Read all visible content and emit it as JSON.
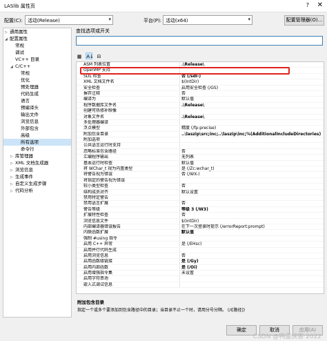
{
  "window": {
    "title": "LASlib 属性页",
    "help": "?",
    "close": "✕"
  },
  "config": {
    "config_label": "配置(C):",
    "config_value": "活动(Release)",
    "platform_label": "平台(P):",
    "platform_value": "活动(x64)",
    "manager_button": "配置管理器(O)..."
  },
  "tree": {
    "items": [
      {
        "label": "通用属性",
        "level": 0,
        "twisty": "▷"
      },
      {
        "label": "配置属性",
        "level": 0,
        "twisty": "◢"
      },
      {
        "label": "常规",
        "level": 1,
        "twisty": ""
      },
      {
        "label": "调试",
        "level": 1,
        "twisty": ""
      },
      {
        "label": "VC++ 目录",
        "level": 1,
        "twisty": ""
      },
      {
        "label": "C/C++",
        "level": 1,
        "twisty": "◢"
      },
      {
        "label": "常规",
        "level": 2,
        "twisty": ""
      },
      {
        "label": "优化",
        "level": 2,
        "twisty": ""
      },
      {
        "label": "预处理器",
        "level": 2,
        "twisty": ""
      },
      {
        "label": "代码生成",
        "level": 2,
        "twisty": ""
      },
      {
        "label": "语言",
        "level": 2,
        "twisty": ""
      },
      {
        "label": "预编译头",
        "level": 2,
        "twisty": ""
      },
      {
        "label": "输出文件",
        "level": 2,
        "twisty": ""
      },
      {
        "label": "浏览信息",
        "level": 2,
        "twisty": ""
      },
      {
        "label": "外部包含",
        "level": 2,
        "twisty": ""
      },
      {
        "label": "高级",
        "level": 2,
        "twisty": ""
      },
      {
        "label": "所有选项",
        "level": 2,
        "twisty": "",
        "selected": true
      },
      {
        "label": "命令行",
        "level": 2,
        "twisty": ""
      },
      {
        "label": "库管理器",
        "level": 1,
        "twisty": "▷"
      },
      {
        "label": "XML 文档生成器",
        "level": 1,
        "twisty": "▷"
      },
      {
        "label": "浏览信息",
        "level": 1,
        "twisty": "▷"
      },
      {
        "label": "生成事件",
        "level": 1,
        "twisty": "▷"
      },
      {
        "label": "自定义生成步骤",
        "level": 1,
        "twisty": "▷"
      },
      {
        "label": "代码分析",
        "level": 1,
        "twisty": "▷"
      }
    ]
  },
  "search": {
    "label": "查找选项或开关",
    "placeholder": ""
  },
  "toolbar": {
    "categorized": "▦",
    "alphabetical": "A↓",
    "pages": "⊟"
  },
  "grid": {
    "rows": [
      {
        "name": "ASM 列表位置",
        "value": ".\\Release\\",
        "bold": true
      },
      {
        "name": "OpenMP 支持",
        "value": ""
      },
      {
        "name": "SDL 检查",
        "value": "否 (/sdl-)",
        "bold": true
      },
      {
        "name": "XML 文档文件名",
        "value": "$(IntDir)"
      },
      {
        "name": "安全检查",
        "value": "启用安全检查 (/GS)"
      },
      {
        "name": "摒弃注释",
        "value": "否"
      },
      {
        "name": "编译为",
        "value": "默认值"
      },
      {
        "name": "程序数据库文件名",
        "value": ".\\Release\\",
        "bold": true
      },
      {
        "name": "创建可热修补映像",
        "value": ""
      },
      {
        "name": "对象文件名",
        "value": ".\\Release\\",
        "bold": true
      },
      {
        "name": "多处理器编译",
        "value": ""
      },
      {
        "name": "浮点模型",
        "value": "精度 (/fp:precise)"
      },
      {
        "name": "附加包含目录",
        "value": "..\\laszip\\src;inc;..\\laszip\\inc;%(AdditionalIncludeDirectories)",
        "bold": true
      },
      {
        "name": "附加选项",
        "value": ""
      },
      {
        "name": "公共语言运行时支持",
        "value": ""
      },
      {
        "name": "忽略标准包含路径",
        "value": "否"
      },
      {
        "name": "汇编程序输出",
        "value": "无列表"
      },
      {
        "name": "基本运行时检查",
        "value": "默认值"
      },
      {
        "name": "将 WChar_t 视为内置类型",
        "value": "是 (/Zc:wchar_t)"
      },
      {
        "name": "将警告视为错误",
        "value": "否 (/WX-)"
      },
      {
        "name": "将指定的警告视为错误",
        "value": ""
      },
      {
        "name": "较小类型检查",
        "value": "否"
      },
      {
        "name": "结构成员对齐",
        "value": "默认设置"
      },
      {
        "name": "禁用特定警告",
        "value": ""
      },
      {
        "name": "禁用语言扩展",
        "value": "否"
      },
      {
        "name": "警告等级",
        "value": "等级 3 (/W3)",
        "bold": true
      },
      {
        "name": "扩展特性检查",
        "value": "否"
      },
      {
        "name": "浏览信息文件",
        "value": "$(IntDir)"
      },
      {
        "name": "内部编译器错误报告",
        "value": "在下一次登录时提示 (/errorReport:prompt)"
      },
      {
        "name": "内联函数扩展",
        "value": "默认值",
        "bold": true
      },
      {
        "name": "强制 #using 指令",
        "value": ""
      },
      {
        "name": "启用 C++ 异常",
        "value": "是 (/EHsc)"
      },
      {
        "name": "启用并行代码生成",
        "value": ""
      },
      {
        "name": "启用浏览信息",
        "value": "否"
      },
      {
        "name": "启用函数级链接",
        "value": "是 (/Gy)",
        "bold": true
      },
      {
        "name": "启用内部函数",
        "value": "是 (/Oi)",
        "bold": true
      },
      {
        "name": "启用增强指令集",
        "value": "未设置"
      },
      {
        "name": "启用字符串池",
        "value": ""
      },
      {
        "name": "嵌入式调试信息",
        "value": ""
      }
    ]
  },
  "description": {
    "title": "附加包含目录",
    "text": "指定一个或多个要添加到包含路径中的目录；当目录不止一个时，请用分号分隔。                       (/I[路径])"
  },
  "footer": {
    "ok": "确定",
    "cancel": "取消",
    "apply": "应用(A)",
    "watermark": "CSDN @鸭蛋侠客 2022"
  }
}
